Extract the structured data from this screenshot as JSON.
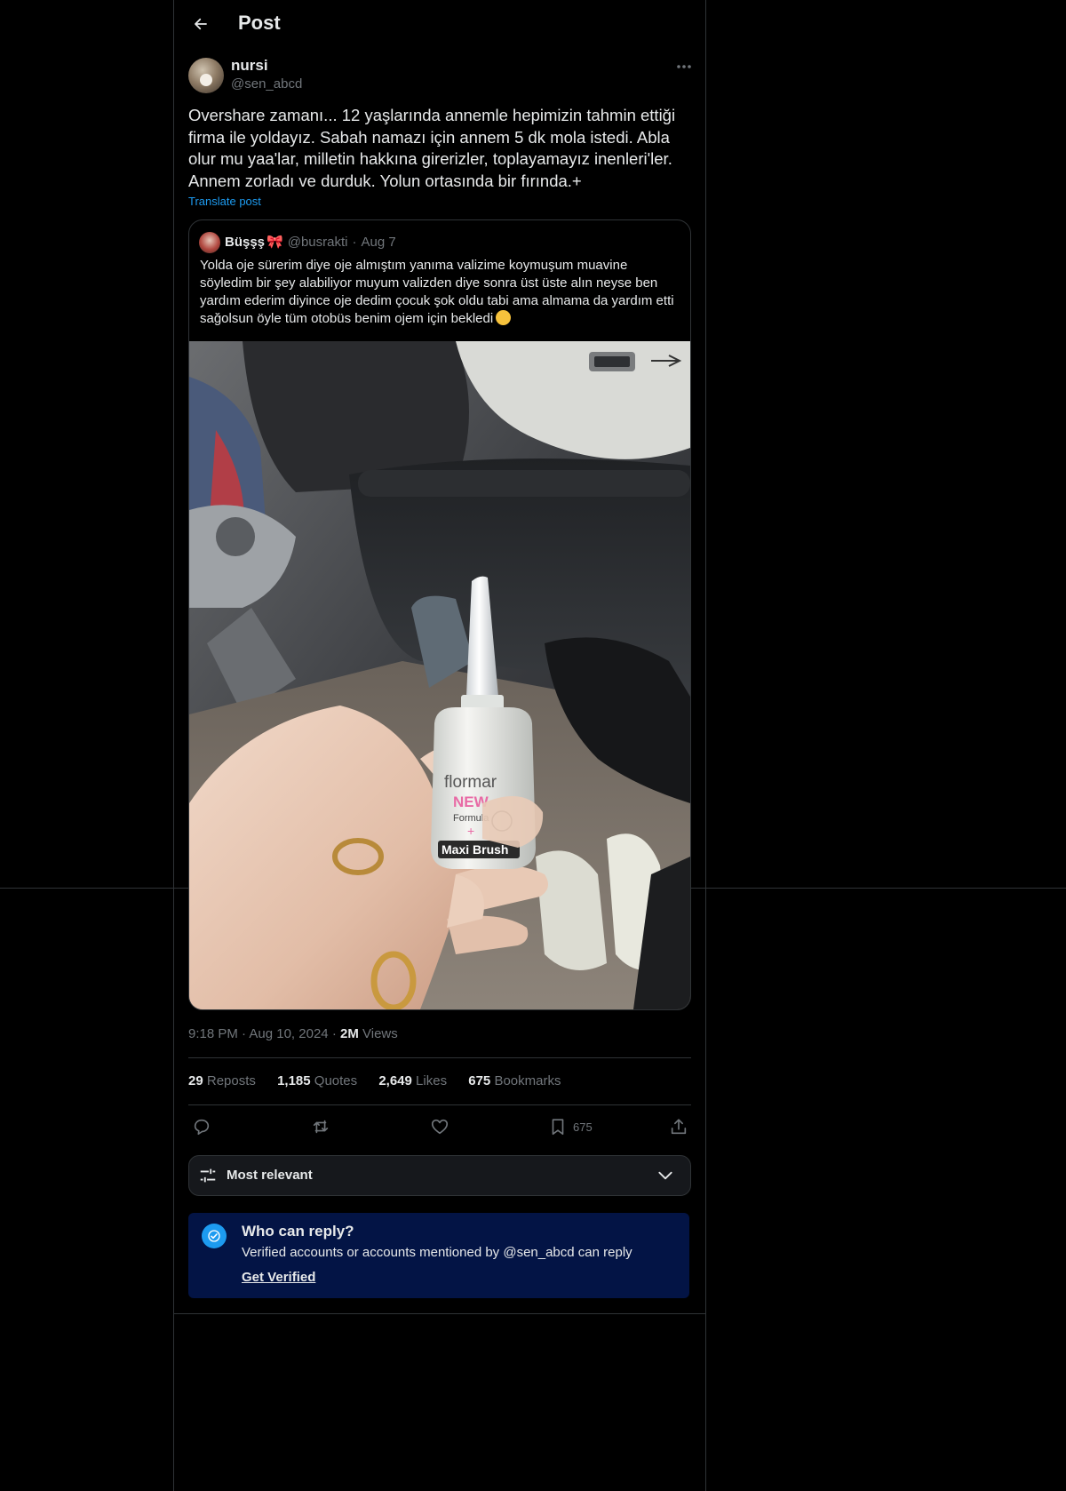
{
  "header": {
    "title": "Post"
  },
  "post": {
    "author_name": "nursi",
    "author_handle": "@sen_abcd",
    "text": "Overshare zamanı... 12 yaşlarında annemle hepimizin tahmin ettiği firma ile yoldayız. Sabah namazı için annem 5 dk mola istedi. Abla olur mu yaa'lar, milletin hakkına girerizler, toplayamayız inenleri'ler. Annem zorladı ve durduk. Yolun ortasında bir fırında.+",
    "translate_label": "Translate post",
    "time": "9:18 PM",
    "date": "Aug 10, 2024",
    "views_count": "2M",
    "views_label": "Views"
  },
  "quote": {
    "name": "Büşşş",
    "name_emoji": "🎀",
    "handle": "@busrakti",
    "separator": "·",
    "date": "Aug 7",
    "text": "Yolda oje sürerim diye oje almıştım yanıma valizime koymuşum muavine söyledim bir şey alabiliyor muyum valizden diye sonra üst üste alın neyse ben yardım ederim diyince oje dedim çocuk şok oldu tabi ama almama da yardım etti sağolsun öyle tüm otobüs benim ojem için bekledi",
    "image": {
      "brand": "flormar",
      "new": "NEW",
      "formula": "Formula",
      "plus": "+",
      "product": "Maxi Brush"
    }
  },
  "stats": {
    "reposts_count": "29",
    "reposts_label": "Reposts",
    "quotes_count": "1,185",
    "quotes_label": "Quotes",
    "likes_count": "2,649",
    "likes_label": "Likes",
    "bookmarks_count": "675",
    "bookmarks_label": "Bookmarks"
  },
  "actions": {
    "bookmark_count": "675",
    "icons": [
      "reply-icon",
      "repost-icon",
      "like-icon",
      "bookmark-icon",
      "share-icon"
    ]
  },
  "sort": {
    "label": "Most relevant"
  },
  "reply_notice": {
    "title": "Who can reply?",
    "description": "Verified accounts or accounts mentioned by @sen_abcd can reply",
    "link": "Get Verified"
  },
  "colors": {
    "background": "#000000",
    "border": "#2f3336",
    "text_primary": "#e7e9ea",
    "text_secondary": "#71767b",
    "accent": "#1d9bf0",
    "notice_background": "#031445"
  }
}
